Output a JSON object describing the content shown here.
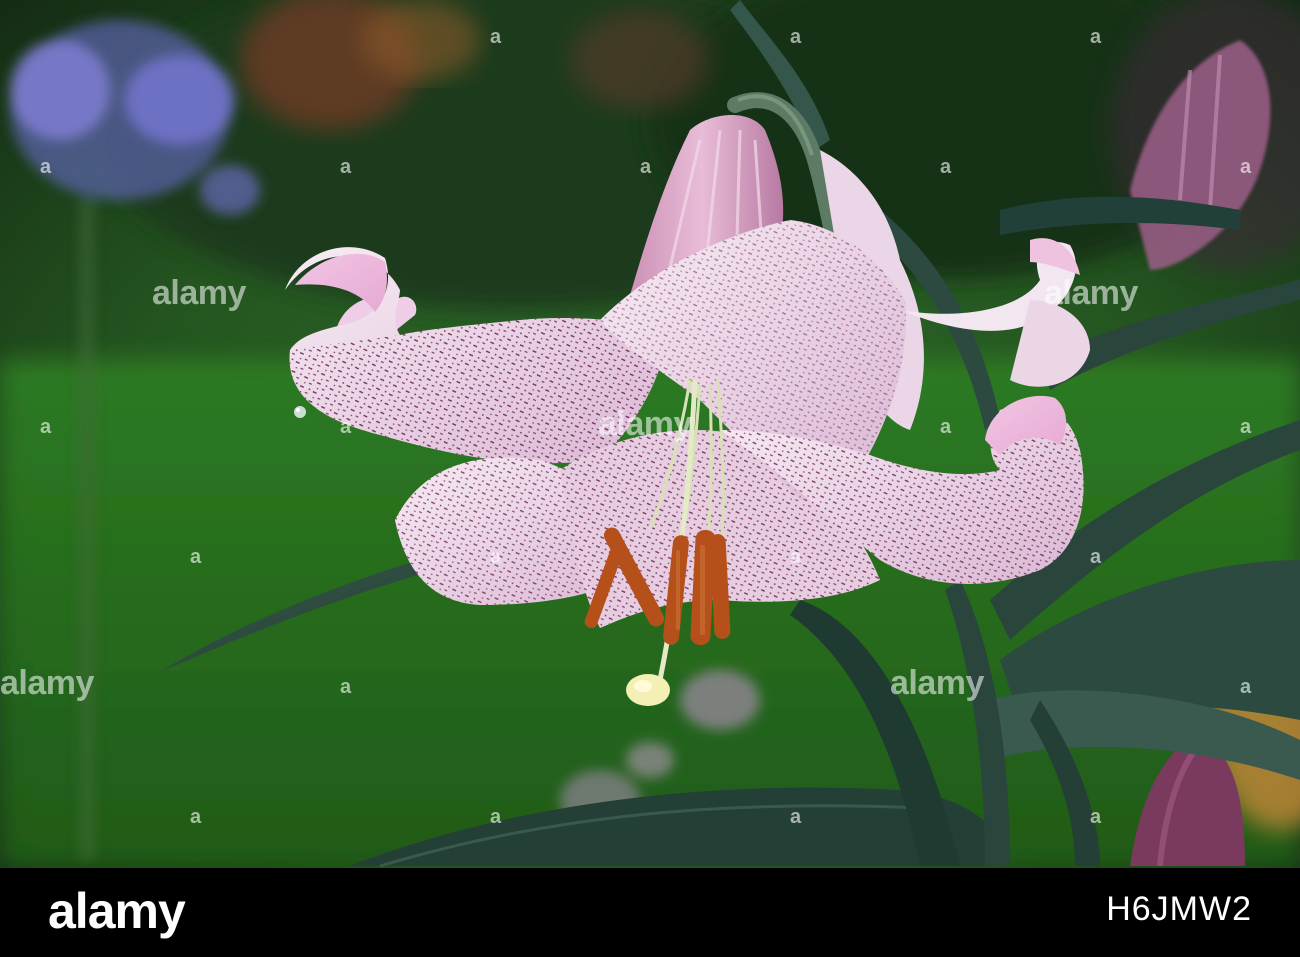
{
  "watermark": {
    "text": "alamy",
    "small": "a"
  },
  "footer": {
    "brand": "alamy",
    "image_id": "H6JMW2"
  },
  "colors": {
    "background_grass": "#2f7a24",
    "foliage_dark": "#1f3a22",
    "petal_white": "#f2e6f0",
    "petal_pink": "#e9b6d9",
    "speckle_purple": "#6a1f4f",
    "anther_orange": "#b5501b",
    "agapanthus_blue": "#6f6fd8",
    "leaf_green": "#2e4a40",
    "bar_black": "#000000"
  },
  "subject": "speckled pink-white lily flower"
}
